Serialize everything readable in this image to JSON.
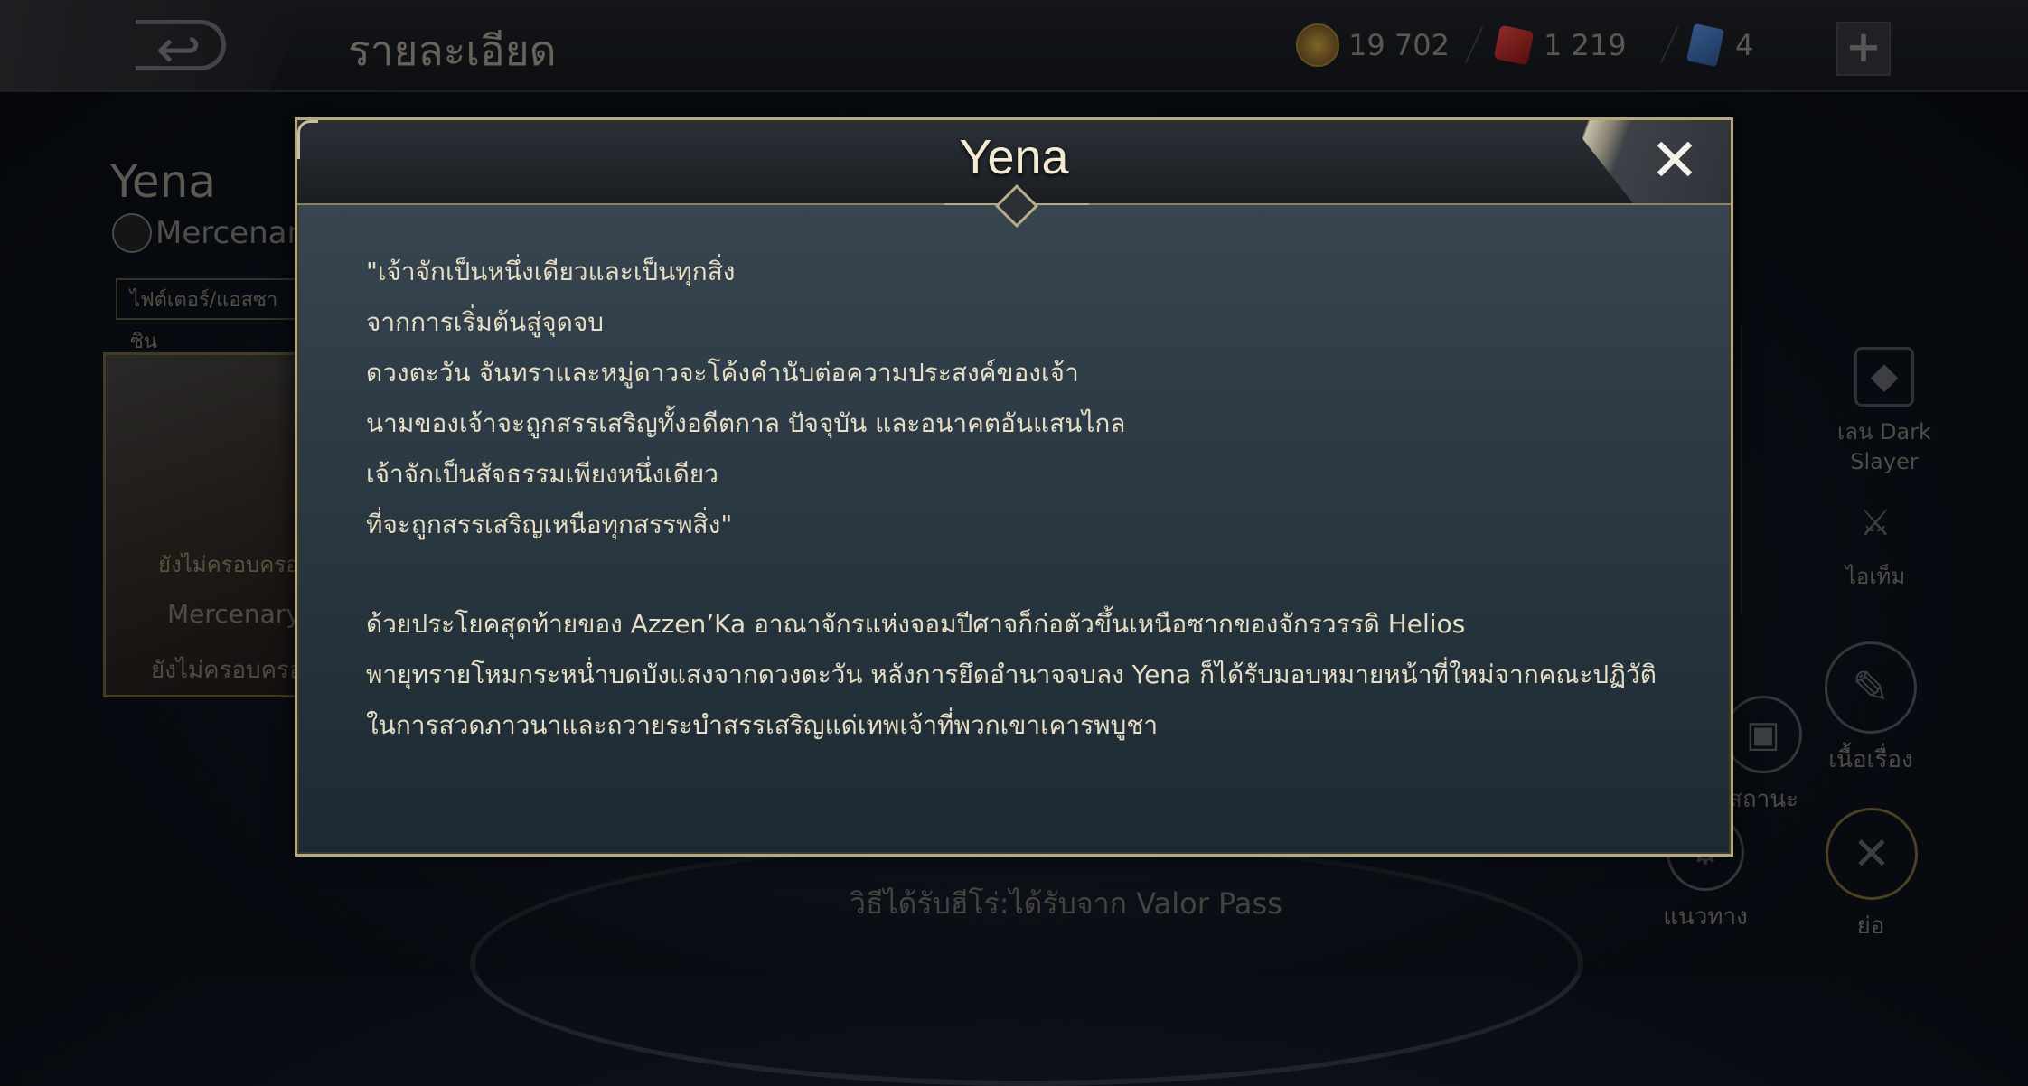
{
  "header": {
    "back_icon": "back-arrow-icon",
    "title": "รายละเอียด",
    "gold": "19 702",
    "vouchers": "1 219",
    "tickets": "4",
    "plus_label": "+"
  },
  "hero": {
    "name": "Yena",
    "class": "Mercenary",
    "role": "ไฟต์เตอร์/แอสซาซิน",
    "skin_card": {
      "text1": "ยังไม่ครอบครอ",
      "text2": "Mercenary",
      "text3": "ยังไม่ครอบครอ"
    }
  },
  "side_menu": {
    "dark_slayer": "เลน Dark Slayer",
    "items": "ไอเท็ม",
    "story": "เนื้อเรื่อง",
    "status": "สถานะ",
    "guide": "แนวทาง",
    "collapse": "ย่อ"
  },
  "bottom": {
    "obtain_text": "วิธีได้รับฮีโร่:ได้รับจาก Valor Pass"
  },
  "modal": {
    "title": "Yena",
    "close_label": "✕",
    "lines": [
      "\"เจ้าจักเป็นหนึ่งเดียวและเป็นทุกสิ่ง",
      "จากการเริ่มต้นสู่จุดจบ",
      "ดวงตะวัน จันทราและหมู่ดาวจะโค้งคำนับต่อความประสงค์ของเจ้า",
      "นามของเจ้าจะถูกสรรเสริญทั้งอดีตกาล ปัจจุบัน และอนาคตอันแสนไกล",
      "เจ้าจักเป็นสัจธรรมเพียงหนึ่งเดียว",
      "ที่จะถูกสรรเสริญเหนือทุกสรรพสิ่ง\"",
      "ด้วยประโยคสุดท้ายของ Azzen’Ka อาณาจักรแห่งจอมปีศาจก็ก่อตัวขึ้นเหนือซากของจักรวรรดิ Helios",
      "พายุทรายโหมกระหน่ำบดบังแสงจากดวงตะวัน หลังการยึดอำนาจจบลง Yena ก็ได้รับมอบหมายหน้าที่ใหม่จากคณะปฏิวัติ",
      "ในการสวดภาวนาและถวายระบำสรรเสริญแด่เทพเจ้าที่พวกเขาเคารพบูชา"
    ]
  }
}
